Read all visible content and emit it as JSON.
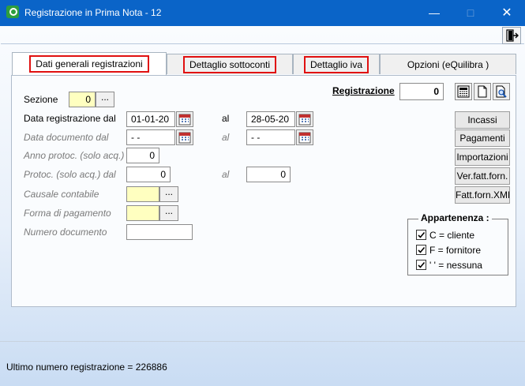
{
  "window": {
    "title": "Registrazione in Prima Nota - 12"
  },
  "tabs": [
    {
      "label": "Dati generali registrazioni"
    },
    {
      "label": "Dettaglio sottoconti"
    },
    {
      "label": "Dettaglio iva"
    },
    {
      "label": "Opzioni (eQuilibra )"
    }
  ],
  "form": {
    "sezione_label": "Sezione",
    "sezione_value": "0",
    "data_reg_label": "Data registrazione  dal",
    "data_reg_from": "01-01-20",
    "data_reg_al": "al",
    "data_reg_to": "28-05-20",
    "data_doc_label": "Data documento    dal",
    "data_doc_from": "- -",
    "data_doc_al": "al",
    "data_doc_to": "- -",
    "anno_label": "Anno protoc. (solo acq.)",
    "anno_value": "0",
    "protoc_label": "Protoc. (solo acq.)  dal",
    "protoc_from": "0",
    "protoc_al": "al",
    "protoc_to": "0",
    "causale_label": "Causale contabile",
    "causale_value": "",
    "forma_label": "Forma di pagamento",
    "forma_value": "",
    "numero_label": "Numero documento",
    "numero_value": "",
    "ellipsis": "..."
  },
  "registrazione": {
    "label": "Registrazione",
    "value": "0"
  },
  "side_buttons": {
    "incassi": "Incassi",
    "pagamenti": "Pagamenti",
    "importazioni": "Importazioni",
    "ver_fatt": "Ver.fatt.forn.",
    "fatt_xml": "Fatt.forn.XML"
  },
  "appartenenza": {
    "title": "Appartenenza :",
    "items": [
      {
        "label": "C = cliente",
        "checked": true
      },
      {
        "label": "F = fornitore",
        "checked": true
      },
      {
        "label": "' ' = nessuna",
        "checked": true
      }
    ]
  },
  "status": {
    "text": "Ultimo numero registrazione = 226886"
  },
  "colors": {
    "titlebar": "#0a64c8",
    "highlight": "#e01010",
    "required_field": "#ffffc0"
  }
}
